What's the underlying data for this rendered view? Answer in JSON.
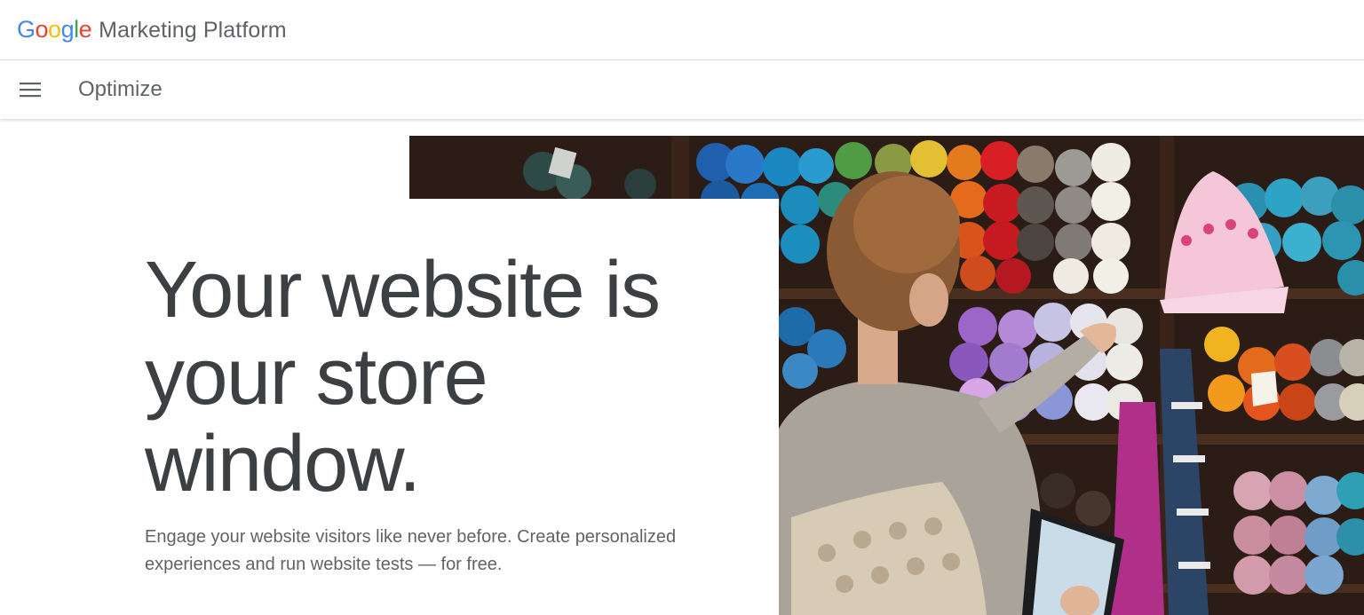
{
  "brand": {
    "google_letters": [
      {
        "char": "G",
        "color": "#4285F4"
      },
      {
        "char": "o",
        "color": "#EA4335"
      },
      {
        "char": "o",
        "color": "#FBBC05"
      },
      {
        "char": "g",
        "color": "#4285F4"
      },
      {
        "char": "l",
        "color": "#34A853"
      },
      {
        "char": "e",
        "color": "#EA4335"
      }
    ],
    "product_suffix": "Marketing Platform"
  },
  "product_nav": {
    "menu_icon": "hamburger-menu-icon",
    "product_name": "Optimize"
  },
  "hero": {
    "headline": "Your website is your store window.",
    "subtext": "Engage your website visitors like never before. Create personalized experiences and run website tests — for free.",
    "image_description_icon": "yarn-store-photo"
  },
  "colors": {
    "text_primary": "#3c4043",
    "text_secondary": "#5f6368",
    "divider": "#dadce0"
  }
}
